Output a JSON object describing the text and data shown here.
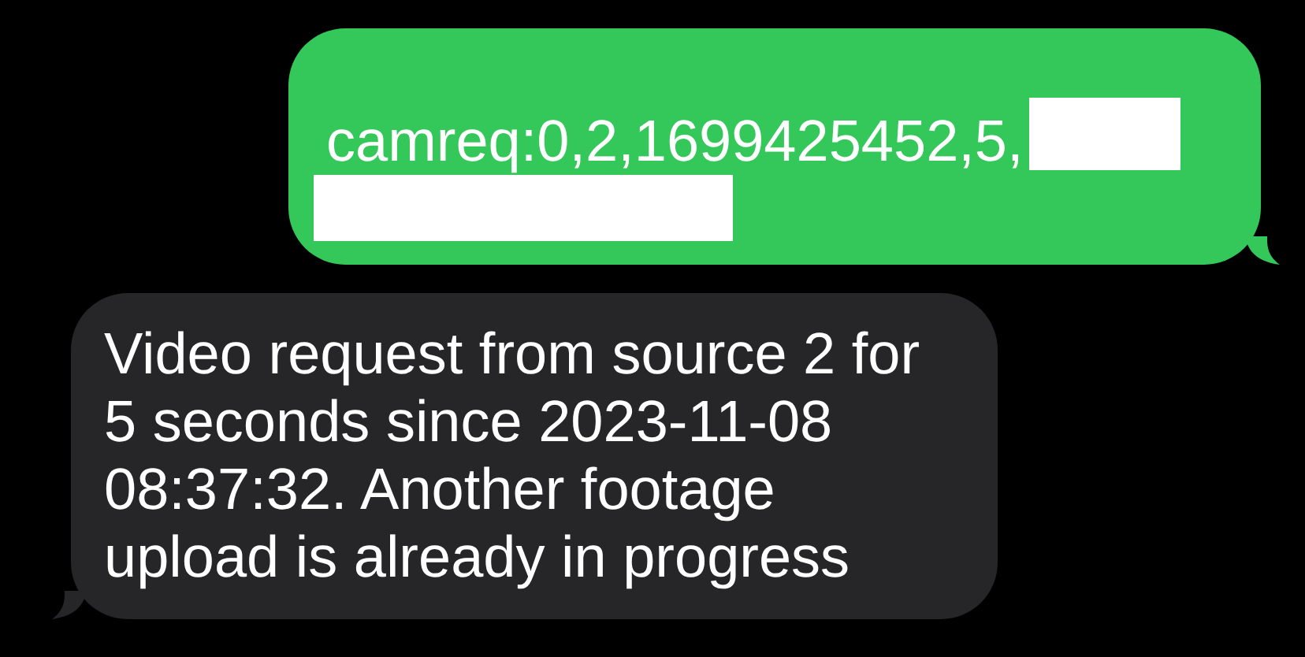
{
  "messages": [
    {
      "kind": "outgoing",
      "text": "camreq:0,2,1699425452,5,",
      "redactions": [
        {
          "kind": "inline"
        },
        {
          "kind": "line"
        }
      ]
    },
    {
      "kind": "incoming",
      "text": "Video request from source 2 for 5 seconds since 2023-11-08 08:37:32. Another footage upload is already in progress"
    }
  ]
}
